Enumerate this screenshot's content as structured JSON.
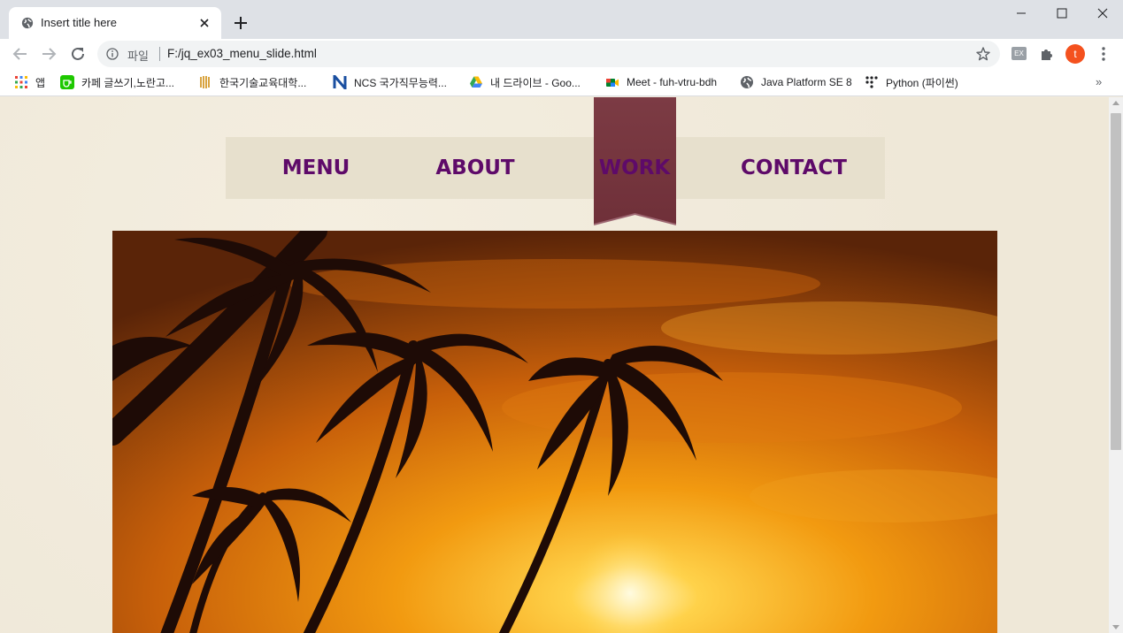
{
  "browser": {
    "tab_title": "Insert title here",
    "address_scheme": "파일",
    "address_url": "F:/jq_ex03_menu_slide.html",
    "profile_initial": "t",
    "extension_label": "EX"
  },
  "bookmarks": [
    {
      "label": "앱",
      "icon": "apps-grid-icon"
    },
    {
      "label": "카페 글쓰기,노란고...",
      "icon": "cafe-icon"
    },
    {
      "label": "한국기술교육대학...",
      "icon": "university-icon"
    },
    {
      "label": "NCS 국가직무능력...",
      "icon": "ncs-icon"
    },
    {
      "label": "내 드라이브 - Goo...",
      "icon": "google-drive-icon"
    },
    {
      "label": "Meet - fuh-vtru-bdh",
      "icon": "google-meet-icon"
    },
    {
      "label": "Java Platform SE 8",
      "icon": "globe-icon"
    },
    {
      "label": "Python (파이썬)",
      "icon": "python-dots-icon"
    }
  ],
  "page": {
    "menu": [
      "MENU",
      "ABOUT",
      "WORK",
      "CONTACT"
    ],
    "active_item": "WORK",
    "colors": {
      "menu_text": "#5e0a69",
      "marker": "#7a3a45",
      "menu_bar": "#e7e0cd"
    }
  }
}
